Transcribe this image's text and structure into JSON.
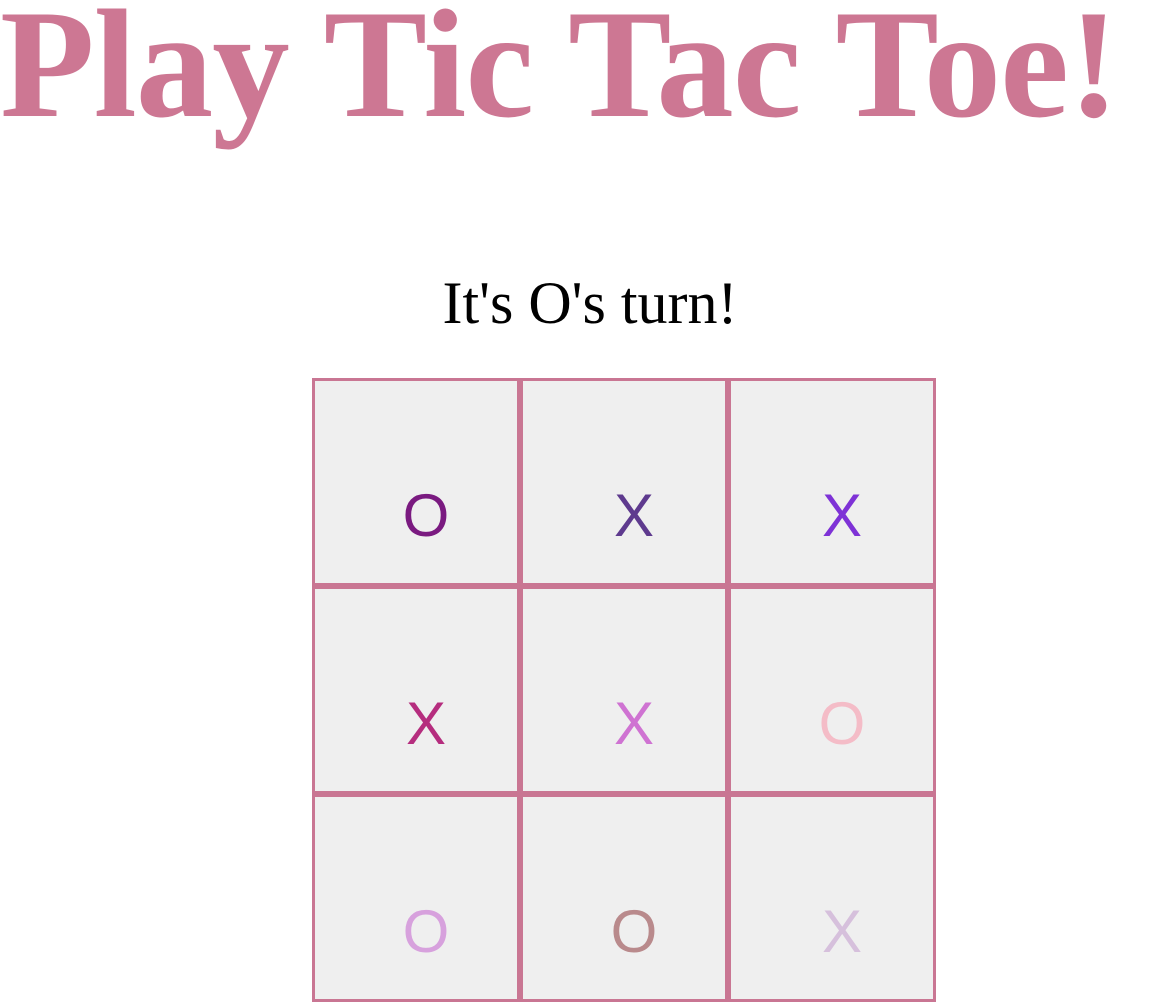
{
  "title": "Play Tic Tac Toe!",
  "status": "It's O's turn!",
  "colors": {
    "title": "#cd7793",
    "board_border": "#c97693",
    "cell_background": "#efefef"
  },
  "board": {
    "cells": [
      {
        "mark": "O",
        "color": "#7a1a80"
      },
      {
        "mark": "X",
        "color": "#5e3a8e"
      },
      {
        "mark": "X",
        "color": "#7e32d6"
      },
      {
        "mark": "X",
        "color": "#b52d7e"
      },
      {
        "mark": "X",
        "color": "#cf73d2"
      },
      {
        "mark": "O",
        "color": "#f4bcc7"
      },
      {
        "mark": "O",
        "color": "#d7a1dd"
      },
      {
        "mark": "O",
        "color": "#b98a8c"
      },
      {
        "mark": "X",
        "color": "#d6c0dc"
      }
    ]
  }
}
